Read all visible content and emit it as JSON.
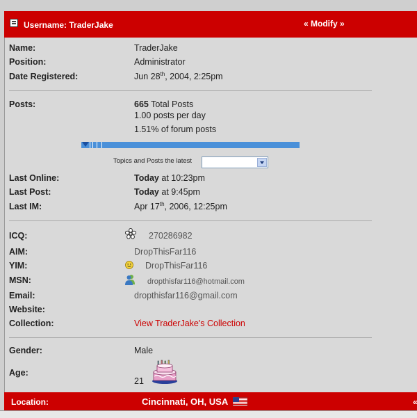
{
  "header": {
    "username_text": "Username: TraderJake",
    "modify_label": "« Modify »"
  },
  "profile": {
    "name_label": "Name:",
    "name_value": "TraderJake",
    "position_label": "Position:",
    "position_value": "Administrator",
    "registered_label": "Date Registered:",
    "registered_pre": "Jun 28",
    "registered_sup": "th",
    "registered_post": ", 2004, 2:25pm",
    "posts_label": "Posts:",
    "posts_count": "665",
    "posts_total_suffix": " Total Posts",
    "posts_per_day": "1.00 posts per day",
    "posts_percent": "1.51% of forum posts",
    "posts_percent_value": 1.51,
    "topics_label": "Topics and Posts the latest",
    "topics_select_value": "",
    "last_online_label": "Last Online:",
    "last_online_day": "Today",
    "last_online_rest": " at 10:23pm",
    "last_post_label": "Last Post:",
    "last_post_day": "Today",
    "last_post_rest": " at 9:45pm",
    "last_im_label": "Last IM:",
    "last_im_pre": "Apr 17",
    "last_im_sup": "th",
    "last_im_post": ", 2006, 12:25pm",
    "icq_label": "ICQ:",
    "icq_value": "270286982",
    "aim_label": "AIM:",
    "aim_value": "DropThisFar116",
    "yim_label": "YIM:",
    "yim_value": "DropThisFar116",
    "msn_label": "MSN:",
    "msn_value": "dropthisfar116@hotmail.com",
    "email_label": "Email:",
    "email_value": "dropthisfar116@gmail.com",
    "website_label": "Website:",
    "collection_label": "Collection:",
    "collection_value": "View TraderJake's Collection",
    "gender_label": "Gender:",
    "gender_value": "Male",
    "age_label": "Age:",
    "age_value": "21"
  },
  "footer": {
    "location_label": "Location:",
    "location_value": "Cincinnati, OH, USA",
    "arrow_text": "«"
  },
  "icons": {
    "header": "profile-card-icon",
    "icq": "icq-flower-icon",
    "yim": "yahoo-smiley-icon",
    "msn": "msn-buddy-icon",
    "age": "birthday-cake-icon",
    "location": "us-flag-icon"
  },
  "colors": {
    "accent": "#cc0000",
    "bar": "#4a90d9"
  }
}
